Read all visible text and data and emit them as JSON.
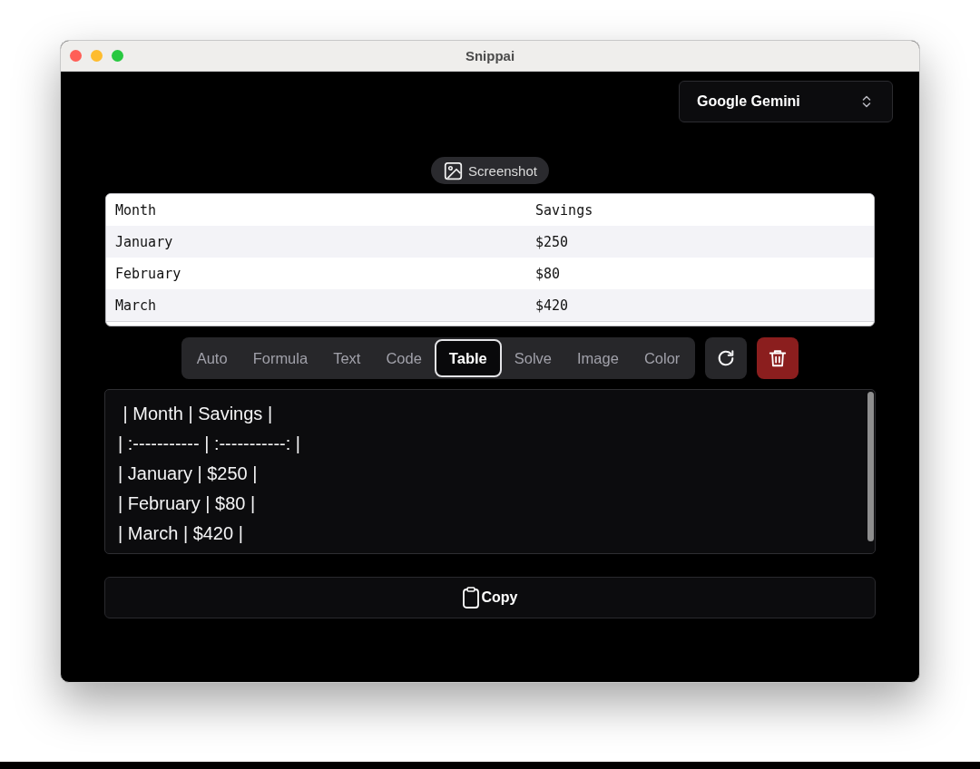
{
  "window": {
    "title": "Snippai"
  },
  "model_select": {
    "value": "Google Gemini"
  },
  "screenshot_button": {
    "label": "Screenshot"
  },
  "table": {
    "columns": [
      "Month",
      "Savings"
    ],
    "rows": [
      [
        "January",
        "$250"
      ],
      [
        "February",
        "$80"
      ],
      [
        "March",
        "$420"
      ]
    ]
  },
  "modes": [
    {
      "label": "Auto",
      "selected": false
    },
    {
      "label": "Formula",
      "selected": false
    },
    {
      "label": "Text",
      "selected": false
    },
    {
      "label": "Code",
      "selected": false
    },
    {
      "label": "Table",
      "selected": true
    },
    {
      "label": "Solve",
      "selected": false
    },
    {
      "label": "Image",
      "selected": false
    },
    {
      "label": "Color",
      "selected": false
    }
  ],
  "output": {
    "value": " | Month | Savings |\n| :----------- | :-----------: |\n| January | $250 |\n| February | $80 |\n| March | $420 |"
  },
  "copy_button": {
    "label": "Copy"
  }
}
